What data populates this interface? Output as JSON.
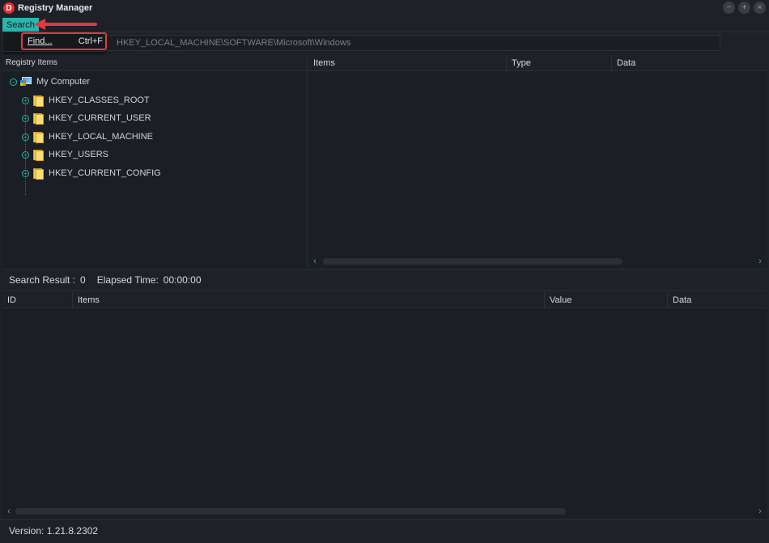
{
  "window": {
    "logo": "D",
    "title": "Registry Manager",
    "controls": [
      "−",
      "+",
      "×"
    ]
  },
  "menu": {
    "search_label": "Search",
    "find_label": "Find...",
    "find_shortcut": "Ctrl+F"
  },
  "path": {
    "value": "HKEY_LOCAL_MACHINE\\SOFTWARE\\Microsoft\\Windows"
  },
  "tree": {
    "header": "Registry Items",
    "root": "My Computer",
    "items": [
      "HKEY_CLASSES_ROOT",
      "HKEY_CURRENT_USER",
      "HKEY_LOCAL_MACHINE",
      "HKEY_USERS",
      "HKEY_CURRENT_CONFIG"
    ]
  },
  "details": {
    "columns": [
      "Items",
      "Type",
      "Data"
    ]
  },
  "search": {
    "result_label": "Search Result :",
    "result_count": "0",
    "elapsed_label": "Elapsed Time:",
    "elapsed_value": "00:00:00",
    "columns": [
      "ID",
      "Items",
      "Value",
      "Data"
    ]
  },
  "footer": {
    "version": "Version: 1.21.8.2302"
  },
  "colors": {
    "accent": "#2cb5ac",
    "highlight": "#e13a3f",
    "background": "#1b1e24"
  }
}
